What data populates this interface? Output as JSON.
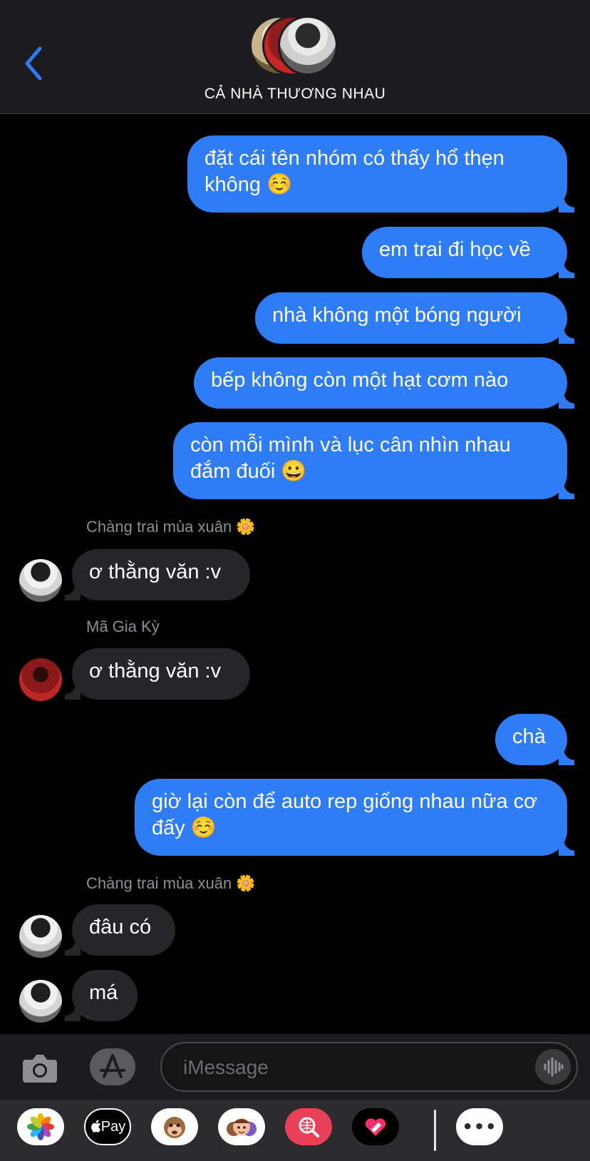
{
  "header": {
    "title": "CẢ NHÀ THƯƠNG NHAU"
  },
  "messages": [
    {
      "dir": "out",
      "text": "đặt cái tên nhóm có thấy hổ thẹn không ☺️"
    },
    {
      "dir": "out",
      "text": "em trai đi học về"
    },
    {
      "dir": "out",
      "text": "nhà không một bóng người"
    },
    {
      "dir": "out",
      "text": "bếp không còn một hạt cơm nào"
    },
    {
      "dir": "out",
      "text": "còn mỗi mình và lục cân nhìn nhau đắm đuối 😀"
    },
    {
      "dir": "in",
      "sender": "Chàng trai mùa xuân",
      "sender_emoji": "🌼",
      "text": "ơ thằng văn :v"
    },
    {
      "dir": "in",
      "sender": "Mã Gia Kỳ",
      "text": "ơ thằng văn :v"
    },
    {
      "dir": "out",
      "text": "chà"
    },
    {
      "dir": "out",
      "text": "giờ lại còn để auto rep giống nhau nữa cơ đấy ☺️"
    },
    {
      "dir": "in",
      "sender": "Chàng trai mùa xuân",
      "sender_emoji": "🌼",
      "text": "đâu có"
    },
    {
      "dir": "in",
      "text": "má"
    }
  ],
  "input": {
    "placeholder": "iMessage"
  },
  "app_drawer": {
    "applepay_label": "Pay",
    "more_label": "•••"
  },
  "colors": {
    "outgoing_bubble": "#2e7cf6",
    "incoming_bubble": "#262628",
    "accent": "#2e7cf6"
  }
}
